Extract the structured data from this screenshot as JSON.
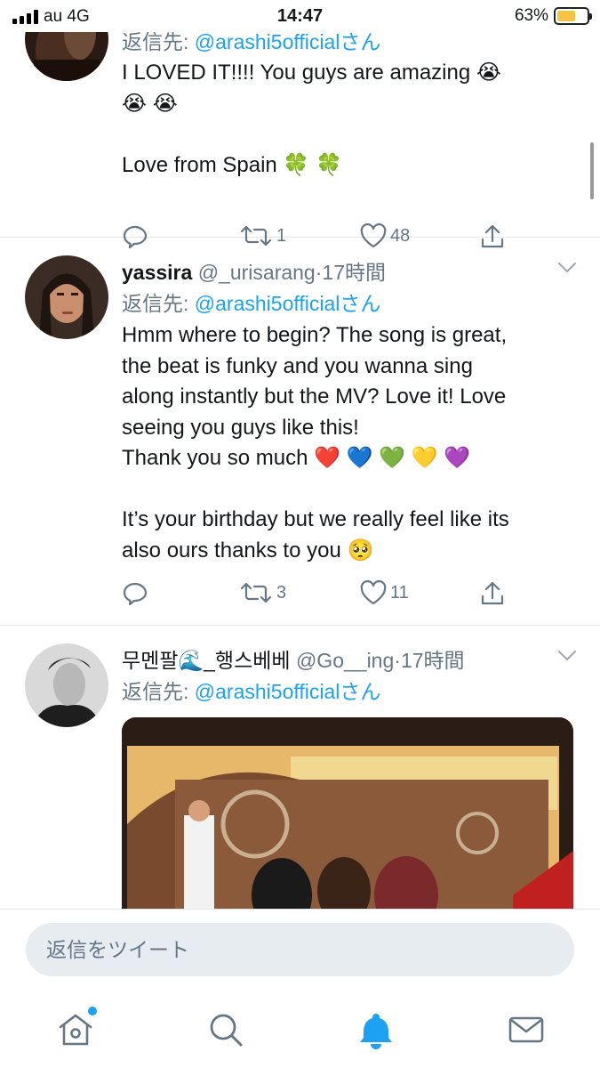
{
  "status_bar": {
    "carrier": "au 4G",
    "time": "14:47",
    "battery": "63%",
    "battery_level": 0.63
  },
  "tweets": [
    {
      "reply_prefix": "返信先:",
      "reply_mention": "@arashi5official",
      "reply_suffix": "さん",
      "body_lines": [
        "I LOVED IT!!!! You guys are amazing 😭",
        "😭 😭",
        "",
        "Love from Spain 🍀 🍀"
      ],
      "retweets": "1",
      "likes": "48"
    },
    {
      "name": "yassira",
      "handle": "@_urisarang",
      "sep": "·",
      "time": "17時間",
      "reply_prefix": "返信先:",
      "reply_mention": "@arashi5official",
      "reply_suffix": "さん",
      "body_lines": [
        "Hmm where to begin? The song is great,",
        "the beat is funky and you wanna sing",
        "along instantly but the MV? Love it! Love",
        "seeing you guys like this!",
        "Thank you so much ❤️ 💙 💚 💛 💜",
        "",
        "It’s your birthday but we really feel like its",
        "also ours thanks to you 🥺"
      ],
      "retweets": "3",
      "likes": "11"
    },
    {
      "name": "무멘팔🌊_행스베베",
      "handle": "@Go__ing",
      "sep": "·",
      "time": "17時間",
      "reply_prefix": "返信先:",
      "reply_mention": "@arashi5official",
      "reply_suffix": "さん"
    }
  ],
  "composer": {
    "placeholder": "返信をツイート"
  },
  "tabbar": {
    "tabs": [
      {
        "icon": "home-icon",
        "has_notification_dot": true
      },
      {
        "icon": "search-icon"
      },
      {
        "icon": "bell-icon",
        "active": true
      },
      {
        "icon": "mail-icon"
      }
    ]
  },
  "colors": {
    "accent": "#1da1f2",
    "secondary_text": "#657786",
    "divider": "#e1e8ed",
    "composer_bg": "#e6ecf0"
  }
}
